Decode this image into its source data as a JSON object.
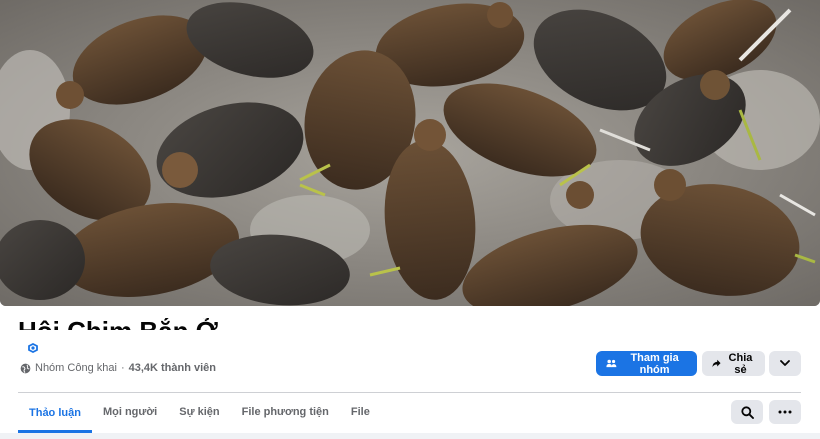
{
  "group": {
    "name": "Hội Chim Bắn Ở Miền",
    "privacy": "Nhóm Công khai",
    "separator": "·",
    "members": "43,4K thành viên"
  },
  "actions": {
    "join_label": "Tham gia nhóm",
    "share_label": "Chia sẻ",
    "join_icon": "group-add-icon",
    "share_icon": "share-arrow-icon",
    "more_icon": "chevron-down-icon"
  },
  "tabs": [
    {
      "label": "Thảo luận",
      "active": true
    },
    {
      "label": "Mọi người",
      "active": false
    },
    {
      "label": "Sự kiện",
      "active": false
    },
    {
      "label": "File phương tiện",
      "active": false
    },
    {
      "label": "File",
      "active": false
    }
  ],
  "tab_actions": {
    "search_icon": "search-icon",
    "more_icon": "more-dots-icon"
  },
  "colors": {
    "accent": "#1b74e4",
    "secondary_button": "#e4e6eb",
    "muted_text": "#65676b"
  },
  "cover": {
    "icon": "cover-photo-birds"
  }
}
